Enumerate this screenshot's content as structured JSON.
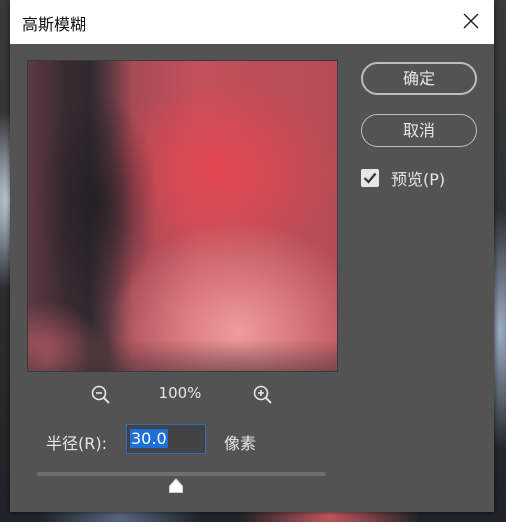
{
  "dialog": {
    "title": "高斯模糊"
  },
  "preview": {
    "zoom_level": "100%"
  },
  "radius": {
    "label": "半径(R):",
    "value": "30.0",
    "unit": "像素",
    "slider_fraction": 0.48
  },
  "buttons": {
    "ok": "确定",
    "cancel": "取消"
  },
  "preview_toggle": {
    "label": "预览(P)",
    "checked": true
  },
  "icons": {
    "close": "close-icon",
    "zoom_out": "zoom-out-icon",
    "zoom_in": "zoom-in-icon",
    "check": "checkmark-icon",
    "thumb": "slider-thumb-icon"
  },
  "colors": {
    "dialog_bg": "#535353",
    "titlebar_bg": "#ffffff",
    "selection": "#1e6fd9"
  }
}
